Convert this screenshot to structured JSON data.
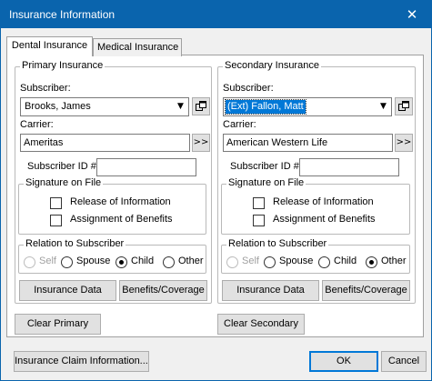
{
  "window": {
    "title": "Insurance Information",
    "close_glyph": "✕"
  },
  "tabs": [
    {
      "label": "Dental Insurance",
      "active": true
    },
    {
      "label": "Medical Insurance",
      "active": false
    }
  ],
  "primary": {
    "group_label": "Primary Insurance",
    "subscriber_label": "Subscriber:",
    "subscriber_value": "Brooks, James",
    "carrier_label": "Carrier:",
    "carrier_value": "Ameritas",
    "carrier_button": ">>",
    "subscriber_id_label": "Subscriber ID #:",
    "subscriber_id_value": "",
    "signature_label": "Signature on File",
    "release_label": "Release of Information",
    "release_checked": false,
    "assignment_label": "Assignment of Benefits",
    "assignment_checked": false,
    "relation_label": "Relation to Subscriber",
    "relation_options": [
      "Self",
      "Spouse",
      "Child",
      "Other"
    ],
    "relation_selected": "Child",
    "insurance_data_button": "Insurance Data",
    "benefits_button": "Benefits/Coverage",
    "clear_button": "Clear Primary"
  },
  "secondary": {
    "group_label": "Secondary Insurance",
    "subscriber_label": "Subscriber:",
    "subscriber_value": "(Ext) Fallon, Matt",
    "carrier_label": "Carrier:",
    "carrier_value": "American Western Life",
    "carrier_button": ">>",
    "subscriber_id_label": "Subscriber ID #:",
    "subscriber_id_value": "",
    "signature_label": "Signature on File",
    "release_label": "Release of Information",
    "release_checked": false,
    "assignment_label": "Assignment of Benefits",
    "assignment_checked": false,
    "relation_label": "Relation to Subscriber",
    "relation_options": [
      "Self",
      "Spouse",
      "Child",
      "Other"
    ],
    "relation_selected": "Other",
    "insurance_data_button": "Insurance Data",
    "benefits_button": "Benefits/Coverage",
    "clear_button": "Clear Secondary"
  },
  "footer": {
    "claim_button": "Insurance Claim Information...",
    "ok_button": "OK",
    "cancel_button": "Cancel"
  },
  "icons": {
    "dropdown": "chevron-down-icon",
    "lookup": "window-lookup-icon"
  },
  "colors": {
    "titlebar": "#0a64ad",
    "selection": "#0078d7",
    "dialog_bg": "#f0f0f0"
  }
}
